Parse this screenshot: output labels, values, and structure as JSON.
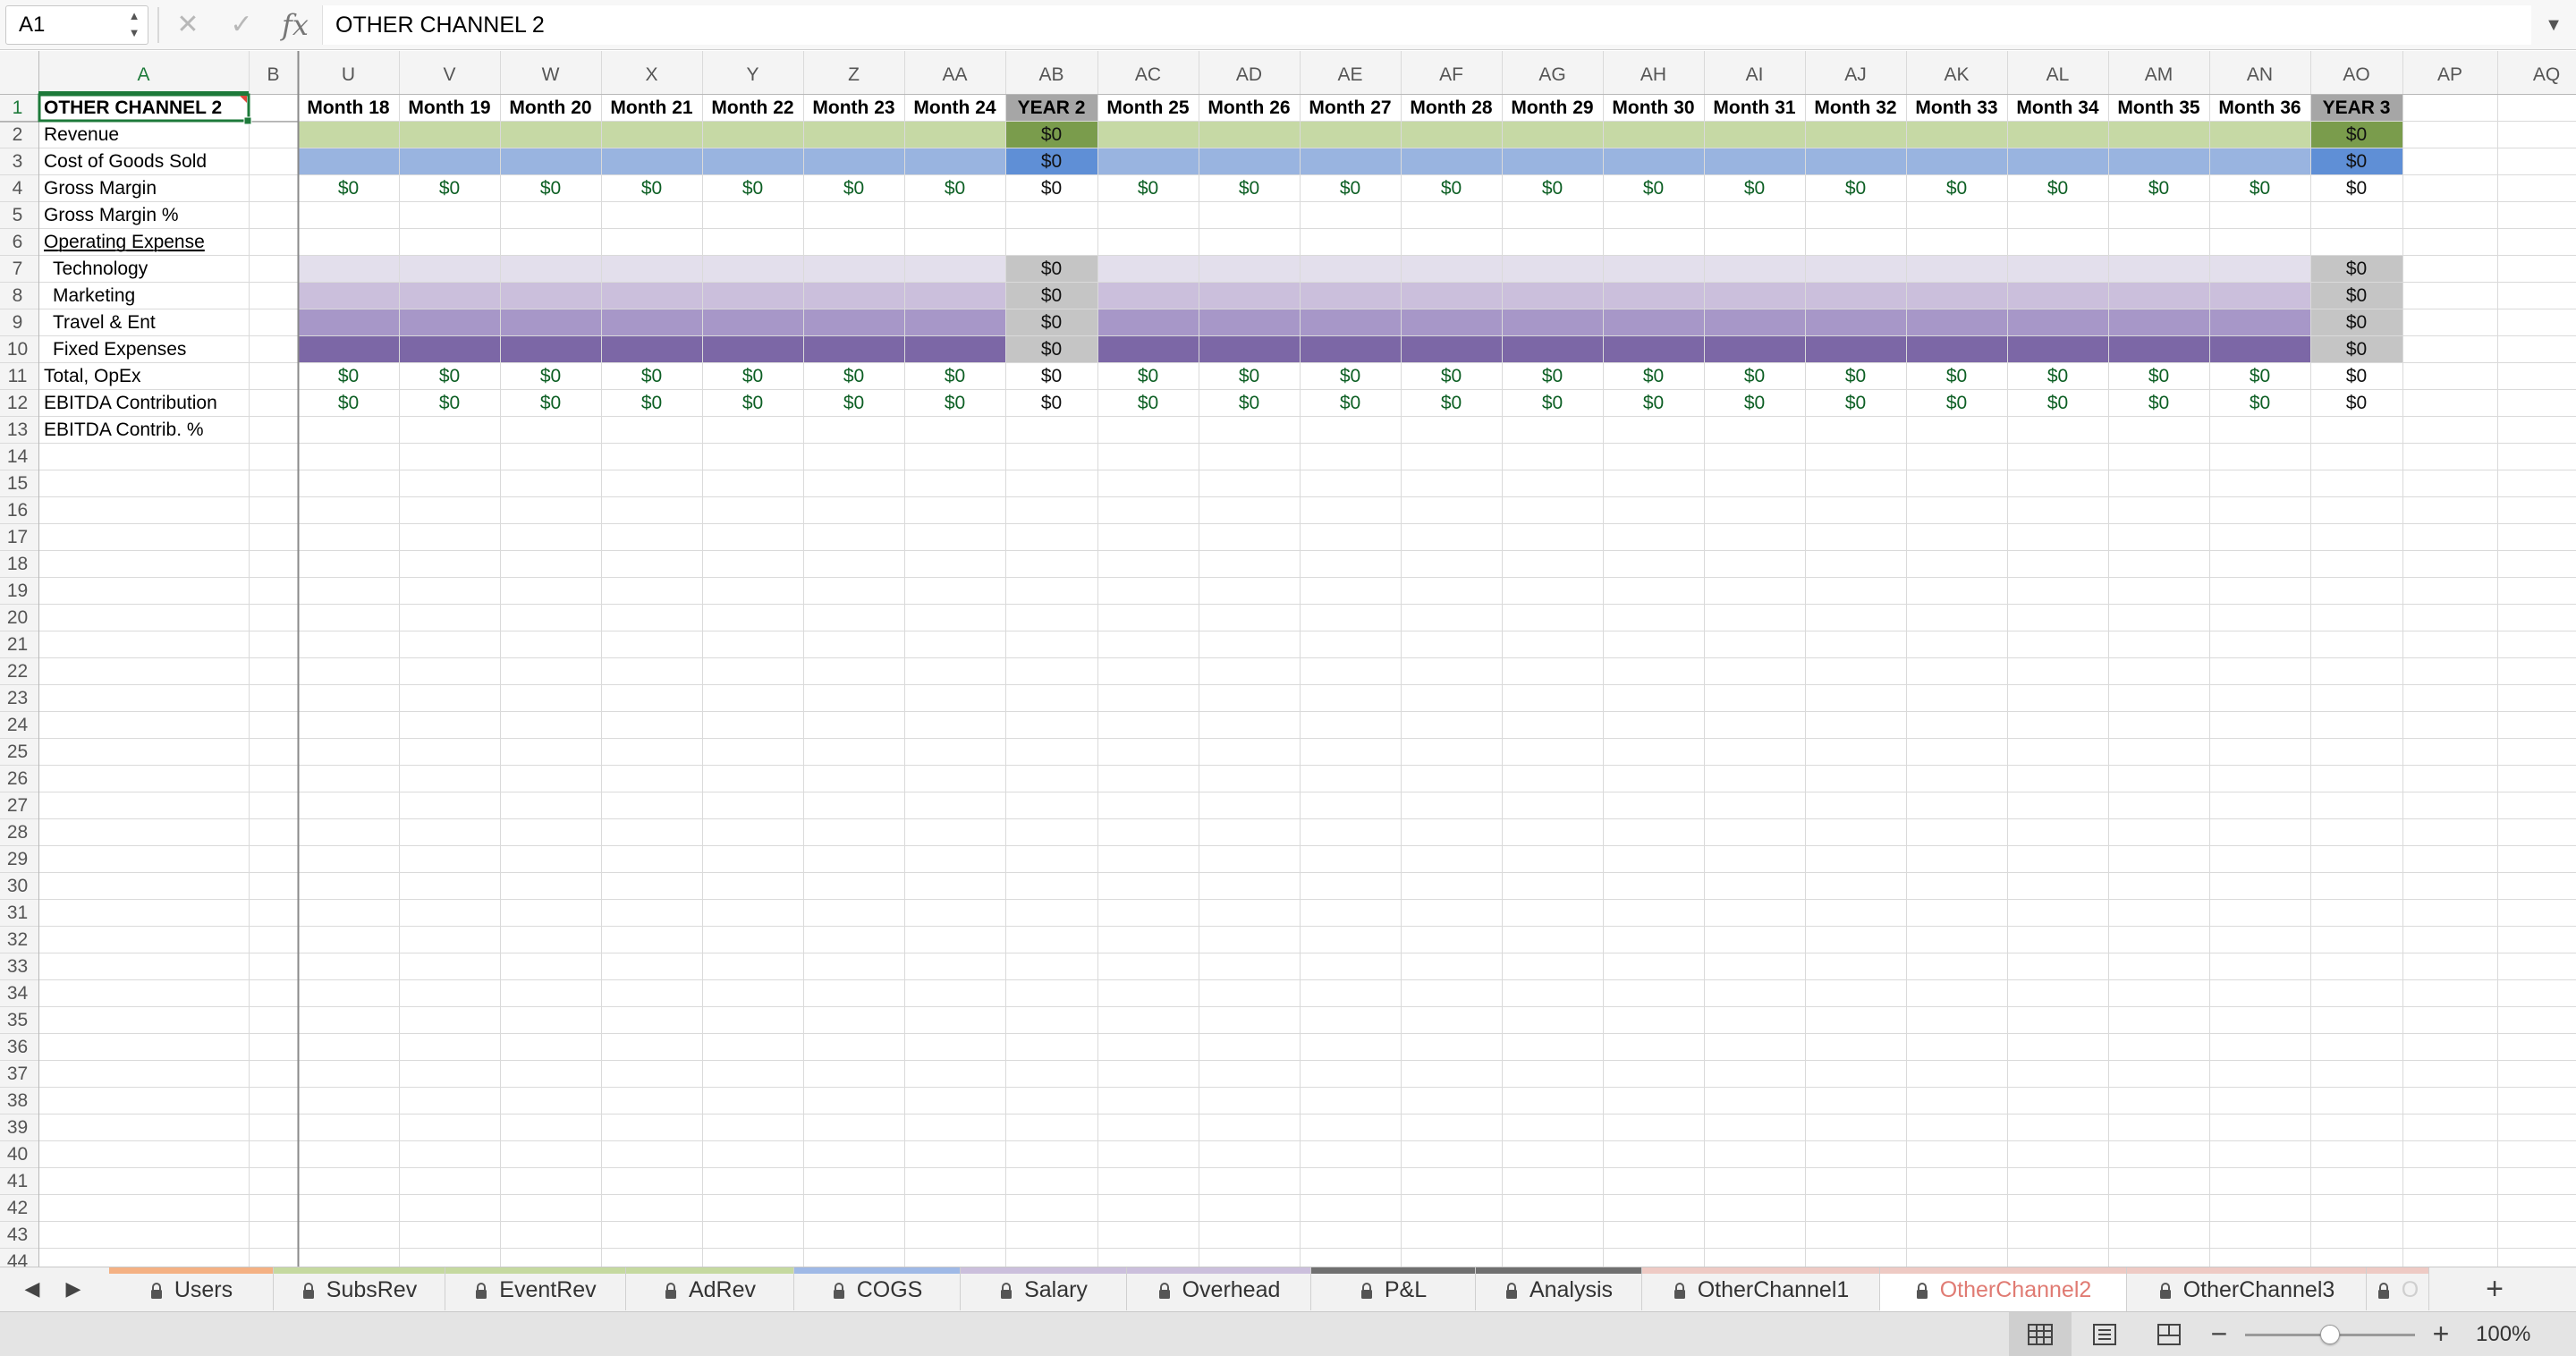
{
  "formula_bar": {
    "name_box": "A1",
    "formula": "OTHER CHANNEL 2",
    "cancel_icon": "x-icon",
    "enter_icon": "check-icon",
    "fx_label": "fx"
  },
  "sheet": {
    "columns": [
      "A",
      "B",
      "U",
      "V",
      "W",
      "X",
      "Y",
      "Z",
      "AA",
      "AB",
      "AC",
      "AD",
      "AE",
      "AF",
      "AG",
      "AH",
      "AI",
      "AJ",
      "AK",
      "AL",
      "AM",
      "AN",
      "AO",
      "AP",
      "AQ"
    ],
    "row_count": 44,
    "selected_cell": "A1",
    "row_labels": [
      "OTHER CHANNEL 2",
      "Revenue",
      "Cost of Goods Sold",
      "Gross Margin",
      "Gross Margin %",
      "Operating Expense",
      "Technology",
      "Marketing",
      "Travel & Ent",
      "Fixed Expenses",
      "Total, OpEx",
      "EBITDA Contribution",
      "EBITDA Contrib. %"
    ],
    "header_row": [
      "Month 18",
      "Month 19",
      "Month 20",
      "Month 21",
      "Month 22",
      "Month 23",
      "Month 24",
      "YEAR 2",
      "Month 25",
      "Month 26",
      "Month 27",
      "Month 28",
      "Month 29",
      "Month 30",
      "Month 31",
      "Month 32",
      "Month 33",
      "Month 34",
      "Month 35",
      "Month 36",
      "YEAR 3"
    ],
    "zero_value": "$0",
    "year_total_columns": [
      "AB",
      "AO"
    ],
    "colors": {
      "revenue_band": "#c6d9a5",
      "revenue_total": "#7a9c4c",
      "cogs_band": "#99b4e0",
      "cogs_total": "#5f8fd6",
      "technology_band": "#e3dfec",
      "marketing_band": "#cbbfdc",
      "travel_band": "#a797c8",
      "fixed_band": "#7c67a6",
      "opex_total": "#c5c5c5",
      "year_header": "#a6a6a6",
      "value_text_green": "#0d5f24",
      "grid_line": "#dadada",
      "header_bg": "#f4f4f4"
    }
  },
  "tabs": [
    {
      "label": "Users",
      "color": "#f4b183"
    },
    {
      "label": "SubsRev",
      "color": "#c5d9a0"
    },
    {
      "label": "EventRev",
      "color": "#c5d9a0"
    },
    {
      "label": "AdRev",
      "color": "#c5d9a0"
    },
    {
      "label": "COGS",
      "color": "#9fb9e6"
    },
    {
      "label": "Salary",
      "color": "#cbbfdc"
    },
    {
      "label": "Overhead",
      "color": "#cbbfdc"
    },
    {
      "label": "P&L",
      "color": "#707070"
    },
    {
      "label": "Analysis",
      "color": "#707070"
    },
    {
      "label": "OtherChannel1",
      "color": "#eecac4"
    },
    {
      "label": "OtherChannel2",
      "color": "#eecac4"
    },
    {
      "label": "OtherChannel3",
      "color": "#eecac4"
    },
    {
      "label": "O",
      "color": "#eecac4"
    }
  ],
  "active_tab": "OtherChannel2",
  "status_bar": {
    "zoom": "100%",
    "view_modes": [
      "normal-view-icon",
      "page-layout-icon",
      "page-break-icon"
    ]
  }
}
